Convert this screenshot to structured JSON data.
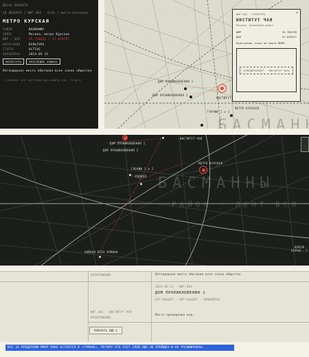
{
  "dossier": {
    "section": "ДОСЬЕ ОБЪЕКТА",
    "breadcrumb": "СВ ОБЪЕКТЕ / ФИГ.003 · SLUG / metro-kurskaya",
    "title": "МЕТРО КУРСКАЯ",
    "fields": [
      {
        "k": "РАЙОН",
        "v": "BASMANNY",
        "red": false
      },
      {
        "k": "АДРЕС",
        "v": "Москва, метро Курская",
        "red": false
      },
      {
        "k": "ШИР / ДОЛ",
        "v": "55.758432 / 37.659707",
        "red": true
      },
      {
        "k": "КАТЕГОРИЯ",
        "v": "КУЛЬТУРА",
        "red": false
      },
      {
        "k": "СТАТУС",
        "v": "ACTIVE",
        "red": false
      },
      {
        "k": "ОБНОВЛЕНО",
        "v": "2024-05-15",
        "red": false
      }
    ],
    "buttons": [
      "#КУЛЬТУРА",
      "#НАСЛЕДИЕ ОБЩАКА"
    ],
    "description": "Легендарное место обитания всех слоев общества",
    "hint": "1 СОВПАЛО ВСЕ КАРТОЧКИ ИЛИ НАЙТИ ССЫ. ТУЗЫ В"
  },
  "map_light": {
    "labels": [
      {
        "id": "dom1",
        "text": "ДОМ ПРОНИКНОВЕНИЯ 1",
        "cls": "dom1"
      },
      {
        "id": "dom2",
        "text": "ДОМ ПРОНИКНОВЕНИЯ 2",
        "cls": "dom2"
      },
      {
        "id": "inst",
        "text": "ИНСТИТУТ",
        "cls": "inst"
      },
      {
        "id": "gar",
        "text": "ГАРАЖИ 1 и 2",
        "cls": "gar"
      },
      {
        "id": "metro",
        "text": "МЕТРО КУРСКАЯ",
        "cls": "metro"
      }
    ],
    "watermark": "БАСМАНН"
  },
  "card": {
    "category": "ФИГ.001 · КУЛЬТУРА",
    "title": "ИНСТИТУТ ЧАЯ",
    "address": "Москва, Басманный район",
    "lat_label": "ШИР",
    "lat": "55.760138",
    "lon_label": "ДОЛ",
    "lon": "37.655511",
    "note": "Культурная точка на карте ММАР.",
    "preview": "[ПРЕДПРОСМОТР · ИНСТИТУТ ЧАЯ]",
    "close": "×"
  },
  "map_dark": {
    "labels": [
      {
        "text": "ДОМ ПРОНИКНОВЕНИЯ 1"
      },
      {
        "text": "ИНСТИТУТ ЧАЯ"
      },
      {
        "text": "ДОМ ПРОНИКНОВЕНИЯ 2"
      },
      {
        "text": "ГАРАЖИ 1 и 2"
      },
      {
        "text": "ПОДВАЛ"
      },
      {
        "text": "МЕТРО КУРСКАЯ"
      },
      {
        "text": "ЧАЙНАЯ ВСЕХ КОМНАН"
      }
    ],
    "watermark": "БАСМАННЫ",
    "subwatermark": "РАЙОН · ЛЕНТ БСЯ · О",
    "cursor": "КУРСОР ·",
    "status": "STATUS · Т"
  },
  "list": {
    "row1_caption": "ИЗОБРАЖЕНИЕ",
    "row1_desc": "Легендарное место обитания всех слоев общества",
    "row2_meta": "2024-05-15 · ФИГ.004",
    "row2_title": "ДОМ ПРОНИКНОВЕНИЯ 1",
    "row2_tags": "АРТ-ОБЪЕКТ · АРТ-ОБЪЕКТ · ПРОВАЙТИС",
    "row2_desc": "Место проведения вод.",
    "row2_caption": "ФИГ.001 · ИНСТИТУТ ЧАЯ",
    "row2_caption2": "ИЗОБРАЖЕНИЕ",
    "more_button": "ПОКАЗАТЬ ЕЩЕ 4"
  },
  "banner": "ВСЕ ЗА ПРЕДЕЛАМИ ММАР ПОКА ОСТАЕТСЯ В «ТУМАНЕ», ПОТОМУ ЧТО ЭТОТ СЛОЙ ЕЩЕ НЕ ПРОЙДЕН И НЕ РАСШИФРОВАН.",
  "colors": {
    "accent": "#e0483a",
    "banner": "#2f63d6",
    "dark": "#1a1b18",
    "paper": "#dcdccc"
  }
}
